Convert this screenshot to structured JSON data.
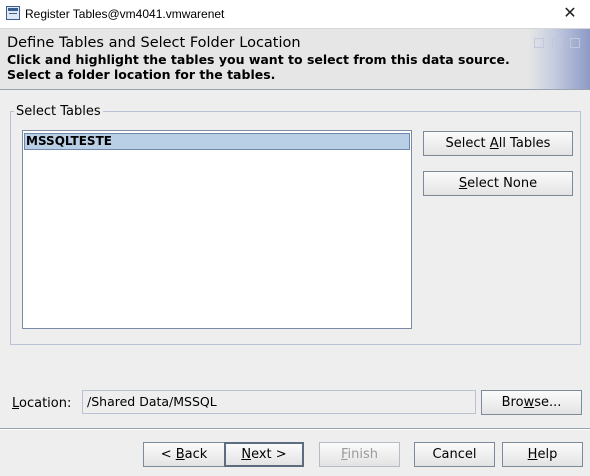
{
  "window": {
    "title": "Register Tables@vm4041.vmwarenet",
    "close_glyph": "✕"
  },
  "header": {
    "title": "Define Tables and Select Folder Location",
    "desc_line1": "Click and highlight the tables you want to select from this data source.",
    "desc_line2": "Select a folder location for the tables."
  },
  "tables_group": {
    "label": "Select Tables",
    "items": [
      "MSSQLTESTE"
    ]
  },
  "buttons": {
    "select_all": {
      "pre": "Select ",
      "mnemonic": "A",
      "post": "ll Tables"
    },
    "select_none": {
      "pre": "",
      "mnemonic": "S",
      "post": "elect None"
    },
    "browse": {
      "pre": "Bro",
      "mnemonic": "w",
      "post": "se..."
    },
    "back": {
      "pre": "< ",
      "mnemonic": "B",
      "post": "ack"
    },
    "next": {
      "pre": "",
      "mnemonic": "N",
      "post": "ext >"
    },
    "finish": {
      "pre": "",
      "mnemonic": "F",
      "post": "inish"
    },
    "cancel": {
      "label": "Cancel"
    },
    "help": {
      "pre": "",
      "mnemonic": "H",
      "post": "elp"
    }
  },
  "location": {
    "label_mnemonic": "L",
    "label_rest": "ocation:",
    "value": "/Shared Data/MSSQL"
  },
  "icons": {
    "app": "register-tables-icon",
    "close": "close-icon"
  }
}
